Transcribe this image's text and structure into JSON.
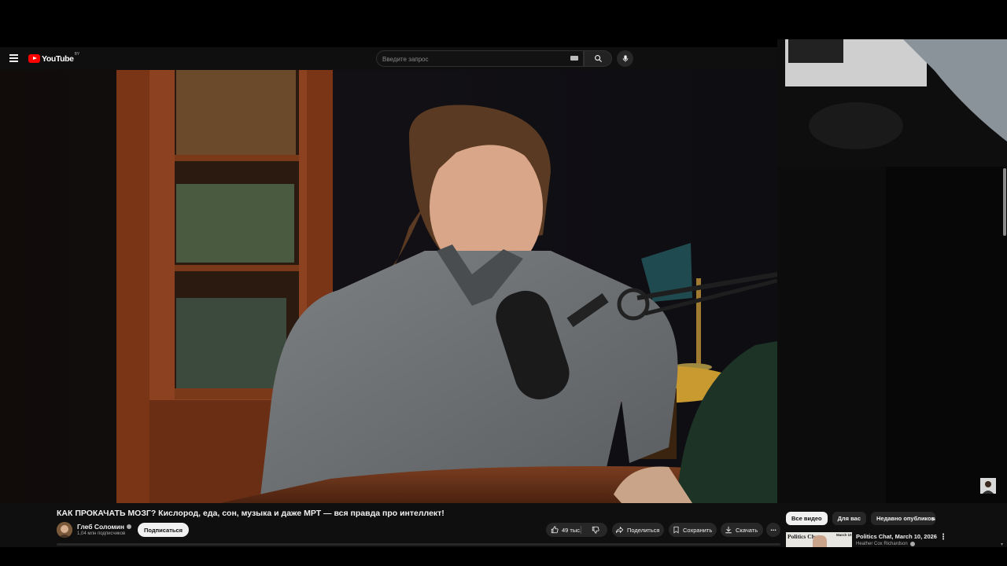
{
  "header": {
    "logo_text": "YouTube",
    "logo_country": "BY",
    "search_placeholder": "Введите запрос",
    "menu_icon": "hamburger-menu-icon",
    "search_icon": "search-icon",
    "mic_icon": "microphone-icon"
  },
  "video": {
    "title": "КАК ПРОКАЧАТЬ МОЗГ? Кислород, еда, сон, музыка и даже МРТ — вся правда про интеллект!"
  },
  "channel": {
    "name": "Глеб Соломин",
    "subscribers": "1,04 млн подписчиков",
    "subscribe_label": "Подписаться"
  },
  "actions": {
    "likes": "49 тыс.",
    "share": "Поделиться",
    "save": "Сохранить",
    "download": "Скачать",
    "more": "⋯"
  },
  "sidebar": {
    "chips": [
      {
        "label": "Все видео",
        "active": true
      },
      {
        "label": "Для вас",
        "active": false
      },
      {
        "label": "Недавно опубликованные",
        "active": false
      }
    ],
    "recommendation": {
      "thumb_title": "Politics Chat",
      "thumb_date": "March 10",
      "title": "Politics Chat, March 10, 2026",
      "author": "Heather Cox Richardson",
      "more": "⋮"
    }
  },
  "colors": {
    "accent_red": "#ff0000",
    "background": "#0f0f0f",
    "text": "#f1f1f1",
    "muted": "#aaaaaa"
  }
}
